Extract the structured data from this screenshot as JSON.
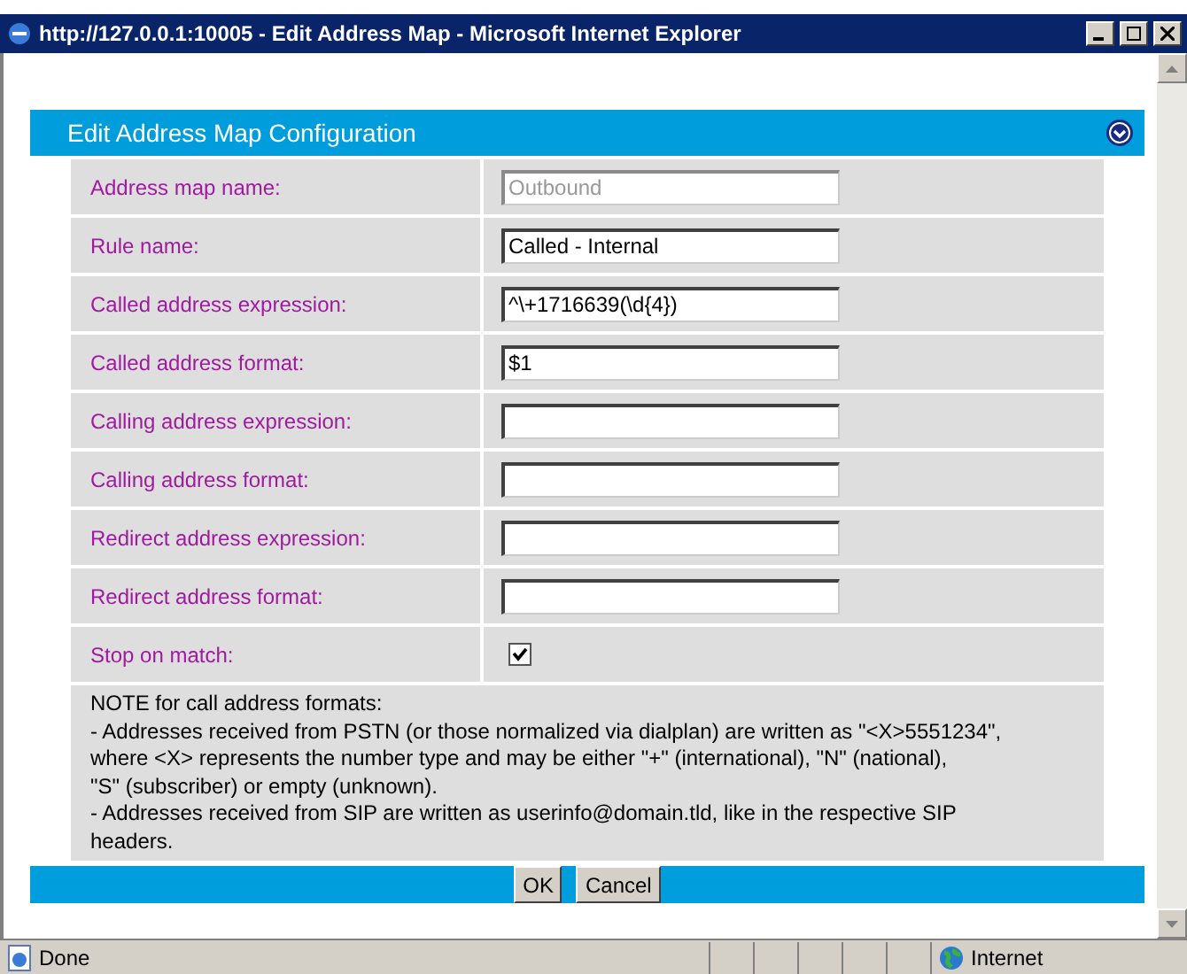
{
  "window": {
    "title": "http://127.0.0.1:10005 - Edit Address Map - Microsoft Internet Explorer"
  },
  "panel": {
    "title": "Edit Address Map Configuration"
  },
  "rows": [
    {
      "kind": "text",
      "label": "Address map name:",
      "value": "Outbound",
      "disabled": true
    },
    {
      "kind": "text",
      "label": "Rule name:",
      "value": "Called - Internal",
      "disabled": false
    },
    {
      "kind": "text",
      "label": "Called address expression:",
      "value": "^\\+1716639(\\d{4})",
      "disabled": false
    },
    {
      "kind": "text",
      "label": "Called address format:",
      "value": "$1",
      "disabled": false
    },
    {
      "kind": "text",
      "label": "Calling address expression:",
      "value": "",
      "disabled": false
    },
    {
      "kind": "text",
      "label": "Calling address format:",
      "value": "",
      "disabled": false
    },
    {
      "kind": "text",
      "label": "Redirect address expression:",
      "value": "",
      "disabled": false
    },
    {
      "kind": "text",
      "label": "Redirect address format:",
      "value": "",
      "disabled": false
    },
    {
      "kind": "checkbox",
      "label": "Stop on match:",
      "checked": true
    }
  ],
  "note": [
    "NOTE for call address formats:",
    "- Addresses received from PSTN (or those normalized via dialplan) are written as \"<X>5551234\",",
    "where <X> represents the number type and may be either \"+\" (international), \"N\" (national),",
    "\"S\" (subscriber) or empty (unknown).",
    "- Addresses received from SIP are written as userinfo@domain.tld, like in the respective SIP",
    "headers."
  ],
  "buttons": [
    "OK",
    "Cancel"
  ],
  "status_bar": {
    "text": "Done",
    "zone": "Internet"
  }
}
